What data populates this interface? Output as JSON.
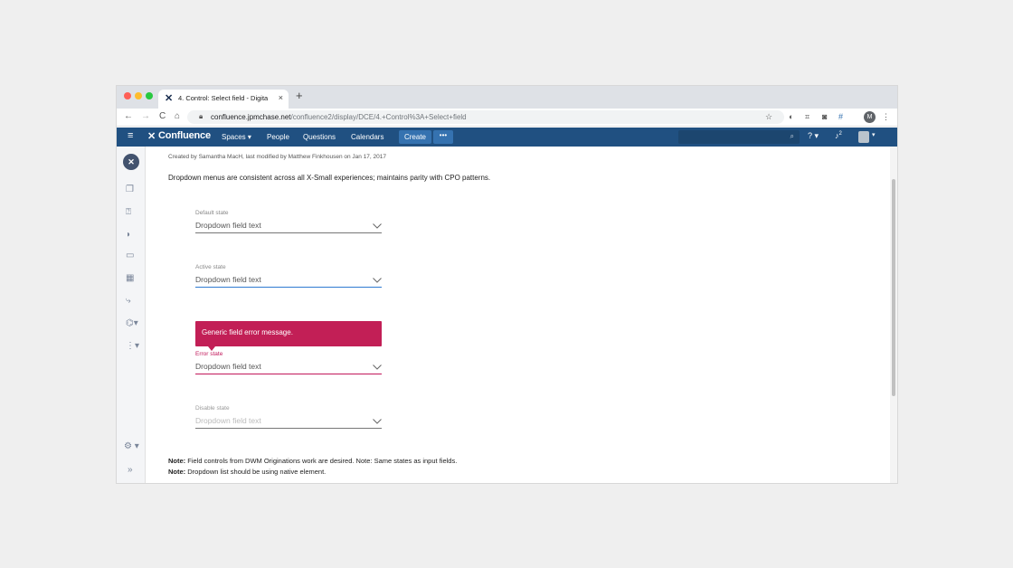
{
  "browser": {
    "tab_title": "4. Control: Select field - Digita",
    "tab_close": "×",
    "new_tab": "+",
    "back": "←",
    "forward": "→",
    "reload": "C",
    "home": "⌂",
    "url_host": "confluence.jpmchase.net",
    "url_path": "/confluence2/display/DCE/4.+Control%3A+Select+field",
    "profile_initial": "M",
    "bookmark_icon": "☆"
  },
  "header": {
    "menu_icon": "≡",
    "logo_mark": "✕",
    "logo_text": "Confluence",
    "nav": [
      "Spaces ▾",
      "People",
      "Questions",
      "Calendars"
    ],
    "create_label": "Create",
    "more_label": "•••",
    "search_icon": "⌕",
    "help_label": "? ▾",
    "notifications_label": "2"
  },
  "page": {
    "meta": "Created by Samantha MacH, last modified by Matthew Finkhousen on Jan 17, 2017",
    "intro": "Dropdown menus are consistent across all X-Small experiences; maintains parity with CPO patterns.",
    "fields": {
      "default": {
        "label": "Default state",
        "value": "Dropdown field text"
      },
      "active": {
        "label": "Active state",
        "value": "Dropdown field text"
      },
      "error": {
        "label": "Error state",
        "value": "Dropdown field text"
      },
      "disabled": {
        "label": "Disable state",
        "value": "Dropdown field text"
      }
    },
    "error_message": "Generic field error message.",
    "notes": [
      {
        "label": "Note:",
        "text": " Field controls from DWM Originations work are desired. Note: Same states as input fields."
      },
      {
        "label": "Note:",
        "text": " Dropdown list should be using native element."
      }
    ]
  },
  "sidebar": {
    "logo": "✕",
    "settings_icon": "⚙ ▾",
    "expand_icon": "»"
  },
  "colors": {
    "header_bg": "#205081",
    "error": "#c21f56",
    "active_underline": "#2f7bd2"
  }
}
